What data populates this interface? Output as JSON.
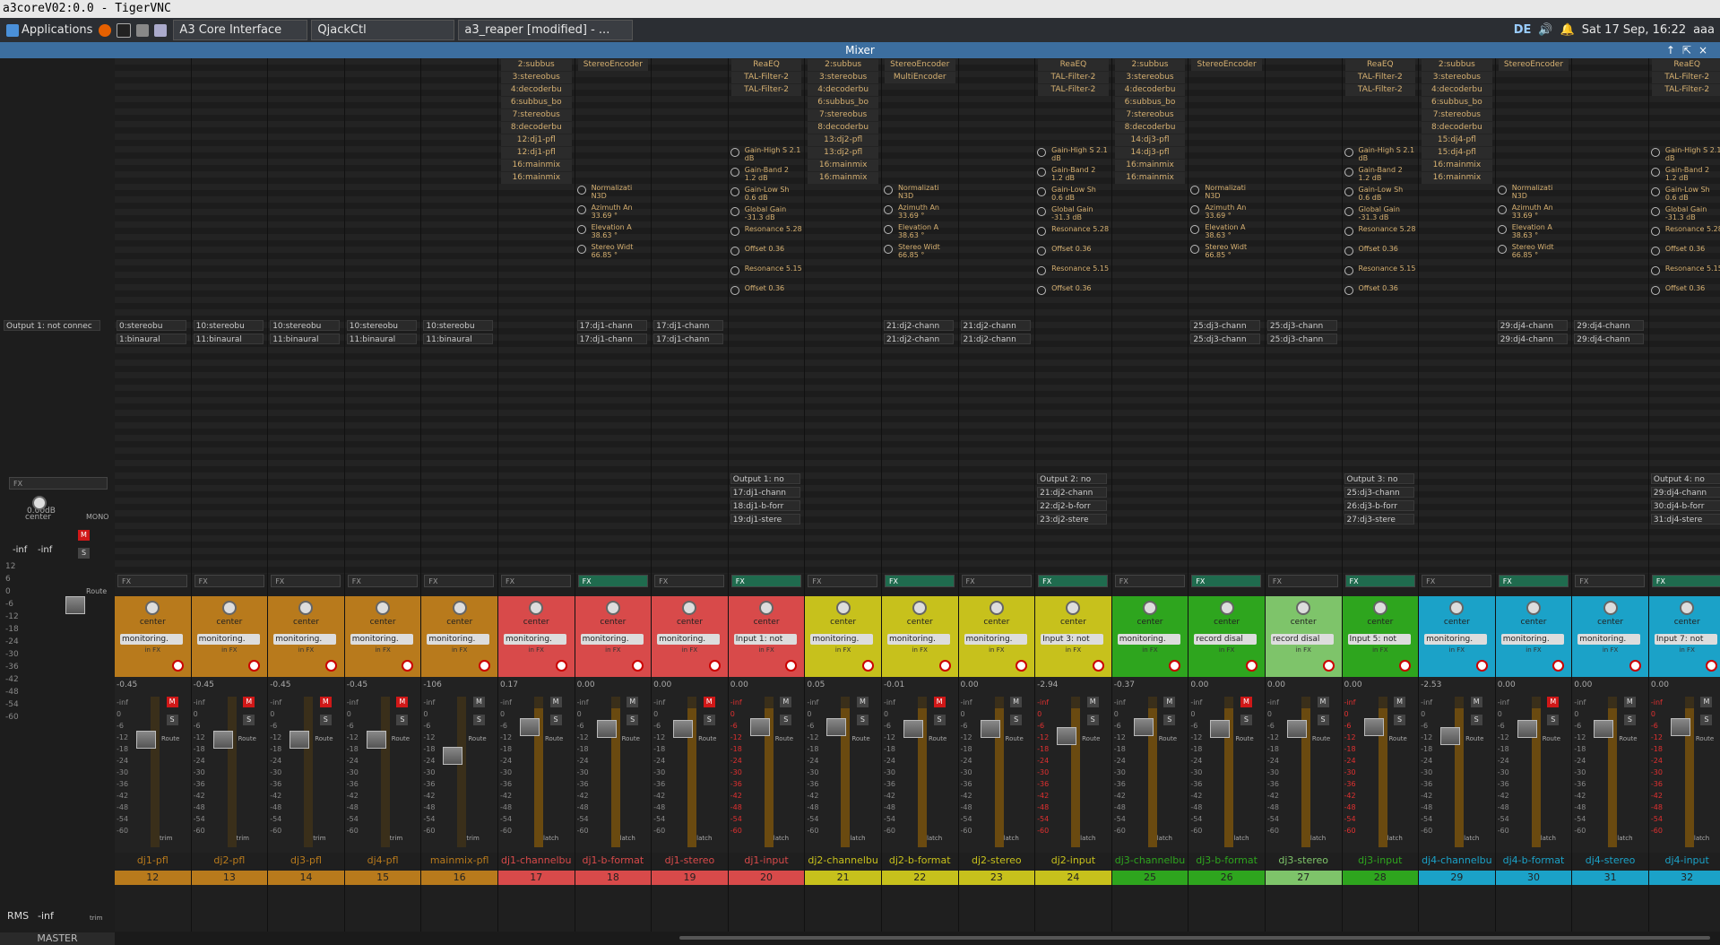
{
  "window_title": "a3coreV02:0.0 - TigerVNC",
  "taskbar": {
    "applications_label": "Applications",
    "tasks": [
      {
        "label": "A3 Core Interface"
      },
      {
        "label": "QjackCtl"
      },
      {
        "label": "a3_reaper [modified] - ..."
      }
    ],
    "keyboard_layout": "DE",
    "clock": "Sat 17 Sep, 16:22",
    "user": "aaa"
  },
  "mixer": {
    "title": "Mixer",
    "master": {
      "label": "MASTER",
      "output": "Output 1: not connec",
      "fx_label": "FX",
      "gain": "0.00dB",
      "pan": "center",
      "mono_label": "MONO",
      "peak_left": "-inf",
      "peak_right": "-inf",
      "route_label": "Route",
      "rms_label": "RMS",
      "rms_value": "-inf",
      "trim_label": "trim",
      "scale": [
        "12",
        "6",
        "0",
        "-6",
        "-12",
        "-18",
        "-24",
        "-30",
        "-36",
        "-42",
        "-48",
        "-54",
        "-60"
      ]
    },
    "common": {
      "fx_label": "FX",
      "pan": "center",
      "in_fx": "in FX",
      "route": "Route",
      "trim": "trim",
      "latch": "latch",
      "m": "M",
      "s": "S",
      "scale": [
        "-inf",
        "0",
        "-6",
        "-12",
        "-18",
        "-24",
        "-30",
        "-36",
        "-42",
        "-48",
        "-54",
        "-60"
      ]
    },
    "strips": [
      {
        "name": "dj1-pfl",
        "num": "12",
        "color": "#b87a1c",
        "input": "monitoring.",
        "gain": "-0.45",
        "fx_on": false,
        "plugins": [],
        "ports": [
          "0:stereobu",
          "1:binaural"
        ],
        "muted": true
      },
      {
        "name": "dj2-pfl",
        "num": "13",
        "color": "#b87a1c",
        "input": "monitoring.",
        "gain": "-0.45",
        "fx_on": false,
        "plugins": [],
        "ports": [
          "10:stereobu",
          "11:binaural"
        ],
        "muted": true
      },
      {
        "name": "dj3-pfl",
        "num": "14",
        "color": "#b87a1c",
        "input": "monitoring.",
        "gain": "-0.45",
        "fx_on": false,
        "plugins": [],
        "ports": [
          "10:stereobu",
          "11:binaural"
        ],
        "muted": true
      },
      {
        "name": "dj4-pfl",
        "num": "15",
        "color": "#b87a1c",
        "input": "monitoring.",
        "gain": "-0.45",
        "fx_on": false,
        "plugins": [],
        "ports": [
          "10:stereobu",
          "11:binaural"
        ],
        "muted": true
      },
      {
        "name": "mainmix-pfl",
        "num": "16",
        "color": "#b87a1c",
        "input": "monitoring.",
        "gain": "-106",
        "fx_on": false,
        "plugins": [],
        "ports": [
          "10:stereobu",
          "11:binaural"
        ],
        "muted": false
      },
      {
        "name": "dj1-channelbu",
        "num": "17",
        "color": "#d84a4a",
        "input": "monitoring.",
        "gain": "0.17",
        "fx_on": false,
        "plugins": [
          "2:subbus",
          "3:stereobus",
          "4:decoderbu",
          "6:subbus_bo",
          "7:stereobus",
          "8:decoderbu",
          "12:dj1-pfl",
          "12:dj1-pfl",
          "16:mainmix",
          "16:mainmix"
        ],
        "ports": [],
        "muted": false
      },
      {
        "name": "dj1-b-format",
        "num": "18",
        "color": "#d84a4a",
        "input": "monitoring.",
        "gain": "0.00",
        "fx_on": true,
        "plugins": [
          "StereoEncoder"
        ],
        "ports": [
          "17:dj1-chann",
          "17:dj1-chann"
        ],
        "muted": false
      },
      {
        "name": "dj1-stereo",
        "num": "19",
        "color": "#d84a4a",
        "input": "monitoring.",
        "gain": "0.00",
        "fx_on": false,
        "plugins": [],
        "ports": [
          "17:dj1-chann",
          "17:dj1-chann"
        ],
        "muted": true
      },
      {
        "name": "dj1-input",
        "num": "20",
        "color": "#d84a4a",
        "input": "Input 1: not",
        "gain": "0.00",
        "fx_on": true,
        "plugins": [
          "ReaEQ",
          "TAL-Filter-2",
          "TAL-Filter-2"
        ],
        "ports": [
          "Output 1: no",
          "17:dj1-chann",
          "18:dj1-b-forr",
          "19:dj1-stere"
        ],
        "muted": false
      },
      {
        "name": "dj2-channelbu",
        "num": "21",
        "color": "#c7c11c",
        "input": "monitoring.",
        "gain": "0.05",
        "fx_on": false,
        "plugins": [
          "2:subbus",
          "3:stereobus",
          "4:decoderbu",
          "6:subbus_bo",
          "7:stereobus",
          "8:decoderbu",
          "13:dj2-pfl",
          "13:dj2-pfl",
          "16:mainmix",
          "16:mainmix"
        ],
        "ports": [],
        "muted": false
      },
      {
        "name": "dj2-b-format",
        "num": "22",
        "color": "#c7c11c",
        "input": "monitoring.",
        "gain": "-0.01",
        "fx_on": true,
        "plugins": [
          "StereoEncoder",
          "MultiEncoder"
        ],
        "ports": [
          "21:dj2-chann",
          "21:dj2-chann"
        ],
        "muted": true
      },
      {
        "name": "dj2-stereo",
        "num": "23",
        "color": "#c7c11c",
        "input": "monitoring.",
        "gain": "0.00",
        "fx_on": false,
        "plugins": [],
        "ports": [
          "21:dj2-chann",
          "21:dj2-chann"
        ],
        "muted": false
      },
      {
        "name": "dj2-input",
        "num": "24",
        "color": "#c7c11c",
        "input": "Input 3: not",
        "gain": "-2.94",
        "fx_on": true,
        "plugins": [
          "ReaEQ",
          "TAL-Filter-2",
          "TAL-Filter-2"
        ],
        "ports": [
          "Output 2: no",
          "21:dj2-chann",
          "22:dj2-b-forr",
          "23:dj2-stere"
        ],
        "muted": false
      },
      {
        "name": "dj3-channelbu",
        "num": "25",
        "color": "#2ea51e",
        "input": "monitoring.",
        "gain": "-0.37",
        "fx_on": false,
        "plugins": [
          "2:subbus",
          "3:stereobus",
          "4:decoderbu",
          "6:subbus_bo",
          "7:stereobus",
          "8:decoderbu",
          "14:dj3-pfl",
          "14:dj3-pfl",
          "16:mainmix",
          "16:mainmix"
        ],
        "ports": [],
        "muted": false
      },
      {
        "name": "dj3-b-format",
        "num": "26",
        "color": "#2ea51e",
        "input": "record disal",
        "gain": "0.00",
        "fx_on": true,
        "plugins": [
          "StereoEncoder"
        ],
        "ports": [
          "25:dj3-chann",
          "25:dj3-chann"
        ],
        "muted": true
      },
      {
        "name": "dj3-stereo",
        "num": "27",
        "color": "#7ec46a",
        "input": "record disal",
        "gain": "0.00",
        "fx_on": false,
        "plugins": [],
        "ports": [
          "25:dj3-chann",
          "25:dj3-chann"
        ],
        "muted": false
      },
      {
        "name": "dj3-input",
        "num": "28",
        "color": "#2ea51e",
        "input": "Input 5: not",
        "gain": "0.00",
        "fx_on": true,
        "plugins": [
          "ReaEQ",
          "TAL-Filter-2",
          "TAL-Filter-2"
        ],
        "ports": [
          "Output 3: no",
          "25:dj3-chann",
          "26:dj3-b-forr",
          "27:dj3-stere"
        ],
        "muted": false
      },
      {
        "name": "dj4-channelbu",
        "num": "29",
        "color": "#1ba2c8",
        "input": "monitoring.",
        "gain": "-2.53",
        "fx_on": false,
        "plugins": [
          "2:subbus",
          "3:stereobus",
          "4:decoderbu",
          "6:subbus_bo",
          "7:stereobus",
          "8:decoderbu",
          "15:dj4-pfl",
          "15:dj4-pfl",
          "16:mainmix",
          "16:mainmix"
        ],
        "ports": [],
        "muted": false
      },
      {
        "name": "dj4-b-format",
        "num": "30",
        "color": "#1ba2c8",
        "input": "monitoring.",
        "gain": "0.00",
        "fx_on": true,
        "plugins": [
          "StereoEncoder"
        ],
        "ports": [
          "29:dj4-chann",
          "29:dj4-chann"
        ],
        "muted": true
      },
      {
        "name": "dj4-stereo",
        "num": "31",
        "color": "#1ba2c8",
        "input": "monitoring.",
        "gain": "0.00",
        "fx_on": false,
        "plugins": [],
        "ports": [
          "29:dj4-chann",
          "29:dj4-chann"
        ],
        "muted": false
      },
      {
        "name": "dj4-input",
        "num": "32",
        "color": "#1ba2c8",
        "input": "Input 7: not",
        "gain": "0.00",
        "fx_on": true,
        "plugins": [
          "ReaEQ",
          "TAL-Filter-2",
          "TAL-Filter-2"
        ],
        "ports": [
          "Output 4: no",
          "29:dj4-chann",
          "30:dj4-b-forr",
          "31:dj4-stere"
        ],
        "muted": false
      }
    ],
    "encoder_params": [
      "Normalizati N3D",
      "Azimuth An 33.69 °",
      "Elevation A 38.63 °",
      "Stereo Widt 66.85 °"
    ],
    "eq_params": [
      "Gain-High S 2.1 dB",
      "Gain-Band 2 1.2 dB",
      "Gain-Low Sh 0.6 dB",
      "Global Gain -31.3 dB",
      "Resonance 5.28",
      "Offset 0.36",
      "Resonance 5.15",
      "Offset 0.36"
    ]
  }
}
